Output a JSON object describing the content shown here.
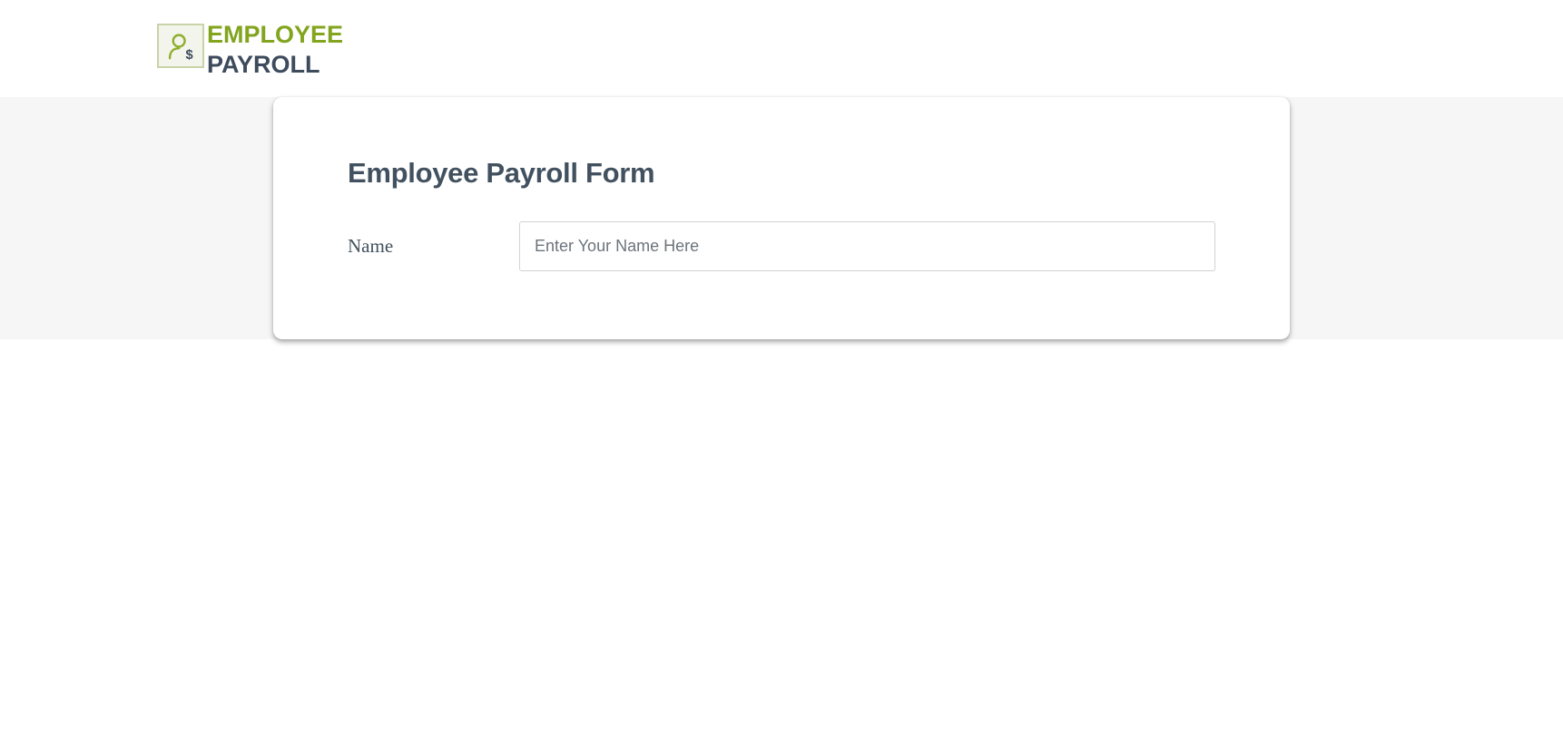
{
  "header": {
    "logo_icon": "employee-dollar-icon",
    "logo_line1": "EMPLOYEE",
    "logo_line2": "PAYROLL"
  },
  "form": {
    "title": "Employee Payroll Form",
    "fields": {
      "name": {
        "label": "Name",
        "value": "",
        "placeholder": "Enter Your Name Here"
      }
    }
  },
  "colors": {
    "brand_green": "#82a41e",
    "brand_dark": "#3d4b5c",
    "band_bg": "#f6f6f6"
  }
}
